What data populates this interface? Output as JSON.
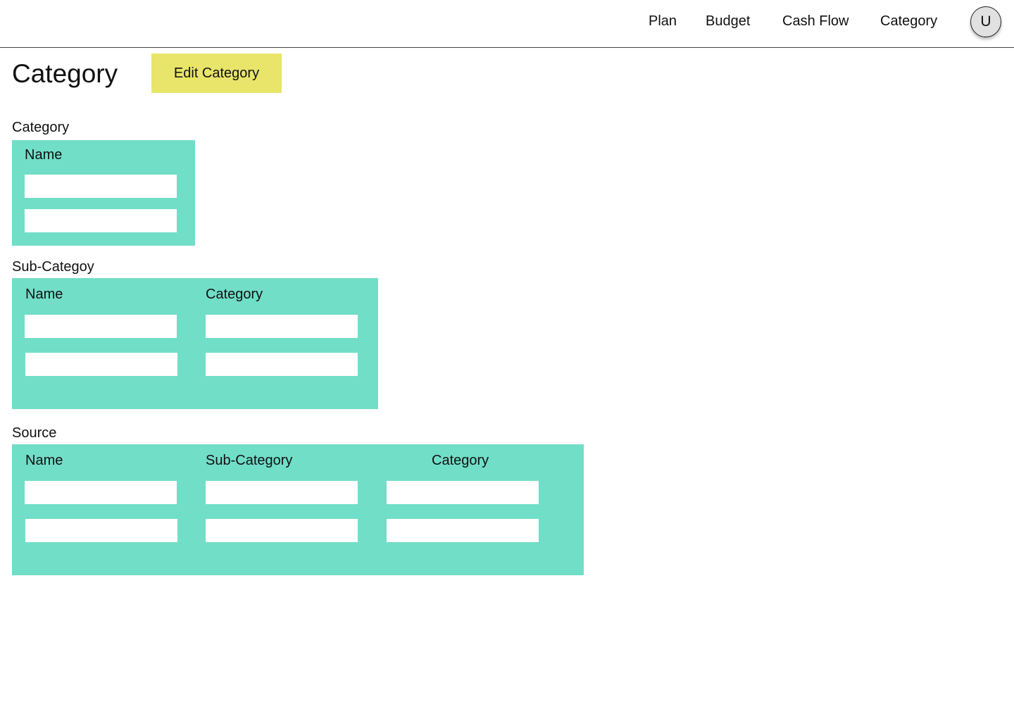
{
  "nav": {
    "items": [
      "Plan",
      "Budget",
      "Cash Flow",
      "Category"
    ],
    "avatar_initial": "U"
  },
  "page": {
    "title": "Category",
    "edit_button_label": "Edit Category"
  },
  "sections": {
    "category": {
      "label": "Category",
      "columns": [
        "Name"
      ],
      "rows": [
        [
          ""
        ],
        [
          ""
        ]
      ]
    },
    "sub_category": {
      "label": "Sub-Categoy",
      "columns": [
        "Name",
        "Category"
      ],
      "rows": [
        [
          "",
          ""
        ],
        [
          "",
          ""
        ]
      ]
    },
    "source": {
      "label": "Source",
      "columns": [
        "Name",
        "Sub-Category",
        "Category"
      ],
      "rows": [
        [
          "",
          "",
          ""
        ],
        [
          "",
          "",
          ""
        ]
      ]
    }
  },
  "colors": {
    "panel": "#71dec8",
    "edit_button": "#e8e56a",
    "avatar": "#e1e1e1"
  }
}
